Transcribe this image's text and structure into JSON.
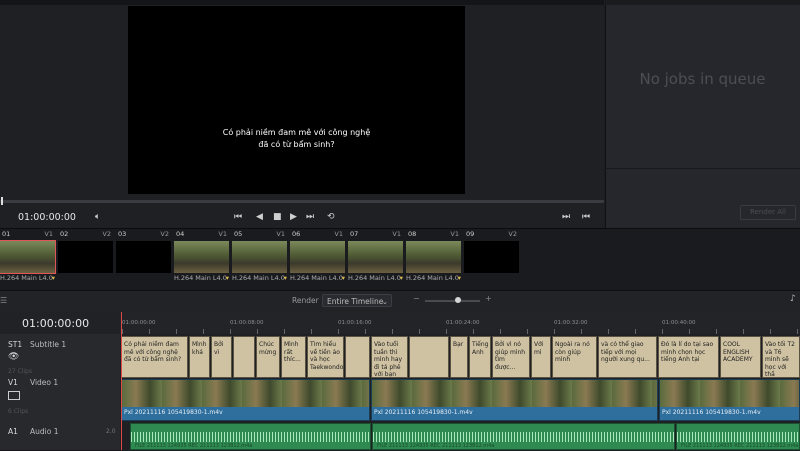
{
  "viewer": {
    "subtitle_line1": "Có phải niềm đam mê với công nghệ",
    "subtitle_line2": "đã có từ bẩm sinh?",
    "timecode": "01:00:00:00"
  },
  "render_queue": {
    "empty_text": "No jobs in queue",
    "render_all_label": "Render All"
  },
  "clips": [
    {
      "num": "01",
      "track": "V1",
      "codec": "H.264 Main L4.0",
      "has_thumb": true
    },
    {
      "num": "02",
      "track": "V2",
      "codec": "",
      "has_thumb": false
    },
    {
      "num": "03",
      "track": "V2",
      "codec": "",
      "has_thumb": false
    },
    {
      "num": "04",
      "track": "V1",
      "codec": "H.264 Main L4.0",
      "has_thumb": true
    },
    {
      "num": "05",
      "track": "V1",
      "codec": "H.264 Main L4.0",
      "has_thumb": true
    },
    {
      "num": "06",
      "track": "V1",
      "codec": "H.264 Main L4.0",
      "has_thumb": true
    },
    {
      "num": "07",
      "track": "V1",
      "codec": "H.264 Main L4.0",
      "has_thumb": true
    },
    {
      "num": "08",
      "track": "V1",
      "codec": "H.264 Main L4.0",
      "has_thumb": true
    },
    {
      "num": "09",
      "track": "V2",
      "codec": "",
      "has_thumb": false
    }
  ],
  "render_bar": {
    "label": "Render",
    "mode": "Entire Timeline"
  },
  "timeline": {
    "timecode": "01:00:00:00",
    "ruler": [
      "01:00:00:00",
      "01:00:08:00",
      "01:00:16:00",
      "01:00:24:00",
      "01:00:32:00",
      "01:00:40:00"
    ],
    "tracks": {
      "subtitle": {
        "id": "ST1",
        "name": "Subtitle 1",
        "sub": "27 Clips"
      },
      "video": {
        "id": "V1",
        "name": "Video 1",
        "sub": "6 Clips"
      },
      "audio": {
        "id": "A1",
        "name": "Audio 1",
        "level": "2.0"
      }
    },
    "subtitles": [
      "Có phải niềm đam mê với công nghệ đã có từ bẩm sinh?",
      "Mình khá",
      "Bởi vì",
      "",
      "Chúc mừng",
      "Mình rất thíc...",
      "Tìm hiểu về tiền ảo và học Taekwondo",
      "",
      "Vào tuổi tuần thì mình hay đi tá phê với bạn bè",
      "",
      "Bạr",
      "Tiếng Anh",
      "Bởi vì nó giúp mình tìm được...",
      "Với mì",
      "Ngoài ra nó còn giúp mình",
      "và có thể giao tiếp với mọi người xung qu...",
      "Đó là lí do tại sao mình chọn học tiếng Anh tại",
      "COOL ENGLISH ACADEMY",
      "Vào tối T2 và T6 mình sẽ học với thầ"
    ],
    "video_clips": [
      "Pxl 20211116 105419830-1.m4v",
      "Pxl 20211116 105419830-1.m4v",
      "Pxl 20211116 105419830-1.m4v"
    ],
    "audio_clips": [
      "FILE 211113 124935 REC 211113 123812.m4a",
      "FILE 211113 124935 REC 211113 123812.m4a",
      "FILE 211113 124935 REC 211113 123812.m4a"
    ]
  }
}
